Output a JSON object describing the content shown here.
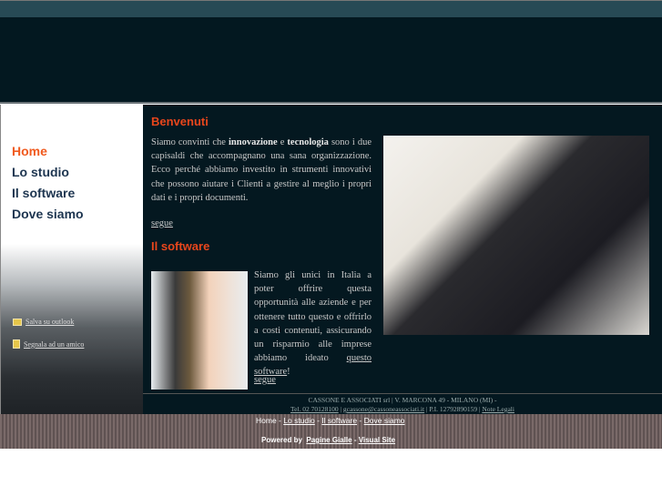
{
  "nav": [
    {
      "label": "Home",
      "active": true
    },
    {
      "label": "Lo studio"
    },
    {
      "label": "Il software"
    },
    {
      "label": "Dove siamo"
    }
  ],
  "sidebar_links": {
    "save": "Salva su outlook",
    "signal": "Segnala ad un amico"
  },
  "welcome": {
    "title": "Benvenuti",
    "p1": "Siamo convinti che ",
    "b1": "innovazione",
    "p2": " e ",
    "b2": "tecnologia",
    "p3": " sono i due capisaldi che accompagnano una sana organizzazione. Ecco perché abbiamo investito in strumenti innovativi che possono aiutare i Clienti a gestire al meglio i propri dati e i propri documenti.",
    "more": "segue"
  },
  "software": {
    "title": "Il software",
    "p1": "Siamo gli unici in Italia a poter offrire questa opportunità alle aziende e per ottenere tutto questo e offrirlo a costi contenuti, assicurando un risparmio alle imprese abbiamo ideato ",
    "link": "questo software",
    "p2": "!",
    "more": "segue"
  },
  "address": {
    "line1": "CASSONE E ASSOCIATI srl | V. MARCONA 49 - MILANO (MI) -",
    "tel": "Tel. 02 70128100",
    "email": "gcassone@cassoneassociati.it",
    "piva": " | P.I. 12792890159 | ",
    "legal": "Note Legali"
  },
  "footer": {
    "links": [
      "Home",
      "Lo studio",
      "Il software",
      "Dove siamo"
    ],
    "powered": "Powered by",
    "pg": "Pagine Gialle",
    "vs": "Visual Site"
  },
  "colors": {
    "accent": "#e8461c",
    "header": "#031820",
    "nav": "#1d3550"
  }
}
